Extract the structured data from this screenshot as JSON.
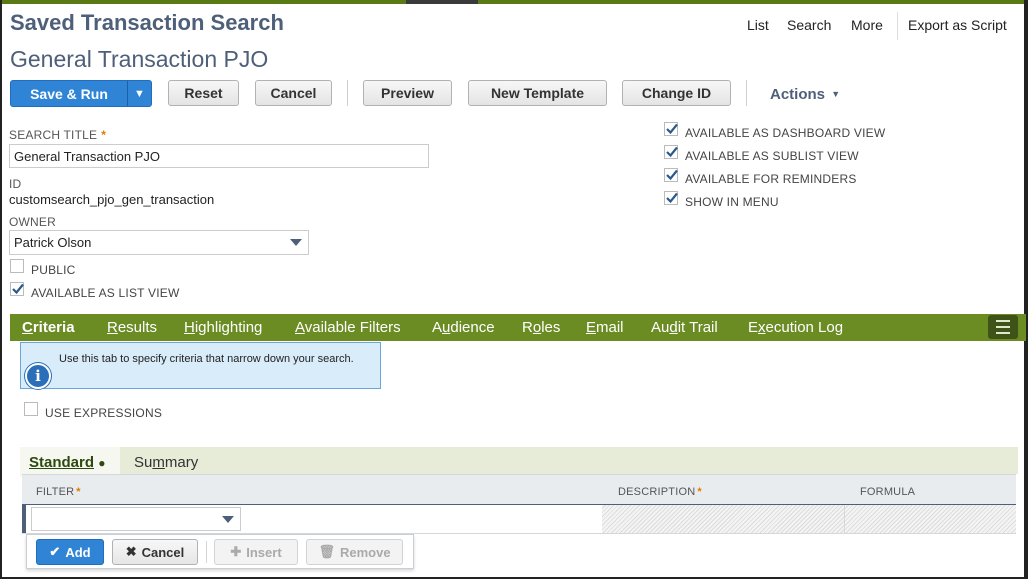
{
  "page": {
    "title": "Saved Transaction Search",
    "subtitle": "General Transaction PJO"
  },
  "top_links": {
    "list": "List",
    "search": "Search",
    "more": "More",
    "export": "Export as Script"
  },
  "toolbar": {
    "save_run": "Save & Run",
    "reset": "Reset",
    "cancel": "Cancel",
    "preview": "Preview",
    "new_template": "New Template",
    "change_id": "Change ID",
    "actions": "Actions"
  },
  "form": {
    "search_title_label": "SEARCH TITLE",
    "search_title_value": "General Transaction PJO",
    "id_label": "ID",
    "id_value": "customsearch_pjo_gen_transaction",
    "owner_label": "OWNER",
    "owner_value": "Patrick Olson",
    "public_label": "PUBLIC",
    "public_checked": false,
    "list_view_label": "AVAILABLE AS LIST VIEW",
    "list_view_checked": true,
    "dashboard_label": "AVAILABLE AS DASHBOARD VIEW",
    "dashboard_checked": true,
    "sublist_label": "AVAILABLE AS SUBLIST VIEW",
    "sublist_checked": true,
    "reminders_label": "AVAILABLE FOR REMINDERS",
    "reminders_checked": true,
    "menu_label": "SHOW IN MENU",
    "menu_checked": true
  },
  "tabs": [
    {
      "pre": "",
      "u": "C",
      "post": "riteria",
      "active": true
    },
    {
      "pre": "",
      "u": "R",
      "post": "esults",
      "active": false
    },
    {
      "pre": "",
      "u": "H",
      "post": "ighlighting",
      "active": false
    },
    {
      "pre": "",
      "u": "A",
      "post": "vailable Filters",
      "active": false
    },
    {
      "pre": "A",
      "u": "u",
      "post": "dience",
      "active": false
    },
    {
      "pre": "R",
      "u": "o",
      "post": "les",
      "active": false
    },
    {
      "pre": "",
      "u": "E",
      "post": "mail",
      "active": false
    },
    {
      "pre": "Au",
      "u": "d",
      "post": "it Trail",
      "active": false
    },
    {
      "pre": "E",
      "u": "x",
      "post": "ecution Log",
      "active": false
    }
  ],
  "criteria": {
    "info_text": "Use this tab to specify criteria that narrow down your search.",
    "use_expressions_label": "USE EXPRESSIONS",
    "use_expressions_checked": false,
    "subtab_standard": "Standard",
    "subtab_summary_pre": "Su",
    "subtab_summary_u": "m",
    "subtab_summary_post": "mary",
    "col_filter": "FILTER",
    "col_description": "DESCRIPTION",
    "col_formula": "FORMULA",
    "filter_value": ""
  },
  "row_actions": {
    "add": "Add",
    "cancel": "Cancel",
    "insert": "Insert",
    "remove": "Remove"
  },
  "colors": {
    "tab_green": "#6b8c23",
    "primary_blue": "#2f84d5",
    "title_slate": "#4d5f79"
  }
}
